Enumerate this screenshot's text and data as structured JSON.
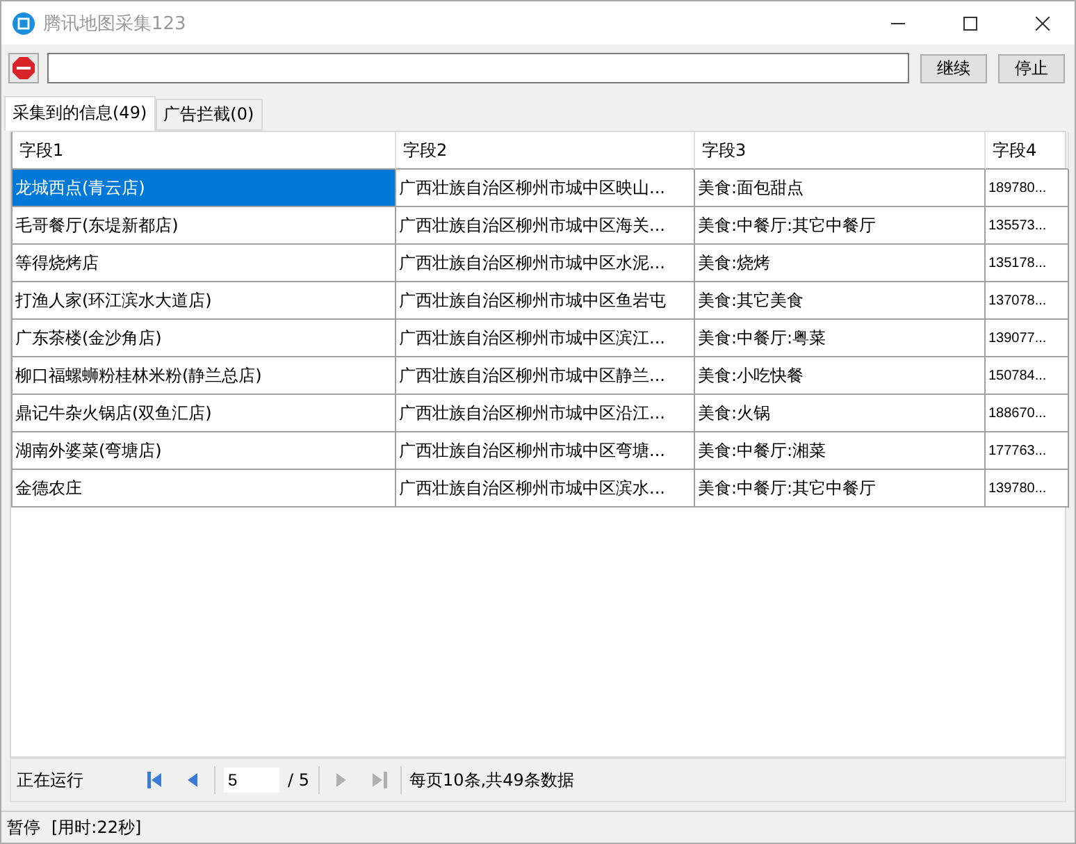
{
  "window": {
    "title": "腾讯地图采集123"
  },
  "toolbar": {
    "buttons": [
      "继续",
      "停止"
    ]
  },
  "tabs": [
    {
      "label": "采集到的信息(49)",
      "selected": true
    },
    {
      "label": "广告拦截(0)",
      "selected": false
    }
  ],
  "table": {
    "columns": [
      "字段1",
      "字段2",
      "字段3",
      "字段4"
    ],
    "rows": [
      {
        "selected": true,
        "cells": [
          "龙城西点(青云店)",
          "广西壮族自治区柳州市城中区映山...",
          "美食:面包甜点",
          "189780..."
        ]
      },
      {
        "selected": false,
        "cells": [
          "毛哥餐厅(东堤新都店)",
          "广西壮族自治区柳州市城中区海关...",
          "美食:中餐厅:其它中餐厅",
          "135573..."
        ]
      },
      {
        "selected": false,
        "cells": [
          "等得烧烤店",
          "广西壮族自治区柳州市城中区水泥...",
          "美食:烧烤",
          "135178..."
        ]
      },
      {
        "selected": false,
        "cells": [
          "打渔人家(环江滨水大道店)",
          "广西壮族自治区柳州市城中区鱼岩屯",
          "美食:其它美食",
          "137078..."
        ]
      },
      {
        "selected": false,
        "cells": [
          "广东茶楼(金沙角店)",
          "广西壮族自治区柳州市城中区滨江...",
          "美食:中餐厅:粤菜",
          "139077..."
        ]
      },
      {
        "selected": false,
        "cells": [
          "柳口福螺蛳粉桂林米粉(静兰总店)",
          "广西壮族自治区柳州市城中区静兰...",
          "美食:小吃快餐",
          "150784..."
        ]
      },
      {
        "selected": false,
        "cells": [
          "鼎记牛杂火锅店(双鱼汇店)",
          "广西壮族自治区柳州市城中区沿江...",
          "美食:火锅",
          "188670..."
        ]
      },
      {
        "selected": false,
        "cells": [
          "湖南外婆菜(弯塘店)",
          "广西壮族自治区柳州市城中区弯塘...",
          "美食:中餐厅:湘菜",
          "177763..."
        ]
      },
      {
        "selected": false,
        "cells": [
          "金德农庄",
          "广西壮族自治区柳州市城中区滨水...",
          "美食:中餐厅:其它中餐厅",
          "139780..."
        ]
      }
    ]
  },
  "pager": {
    "status": "正在运行",
    "page": "5",
    "total": "/ 5",
    "first_disabled": false,
    "prev_disabled": false,
    "next_disabled": true,
    "last_disabled": true,
    "summary": "每页10条,共49条数据"
  },
  "status_bar": {
    "state": "暂停",
    "elapsed": "[用时:22秒]"
  }
}
